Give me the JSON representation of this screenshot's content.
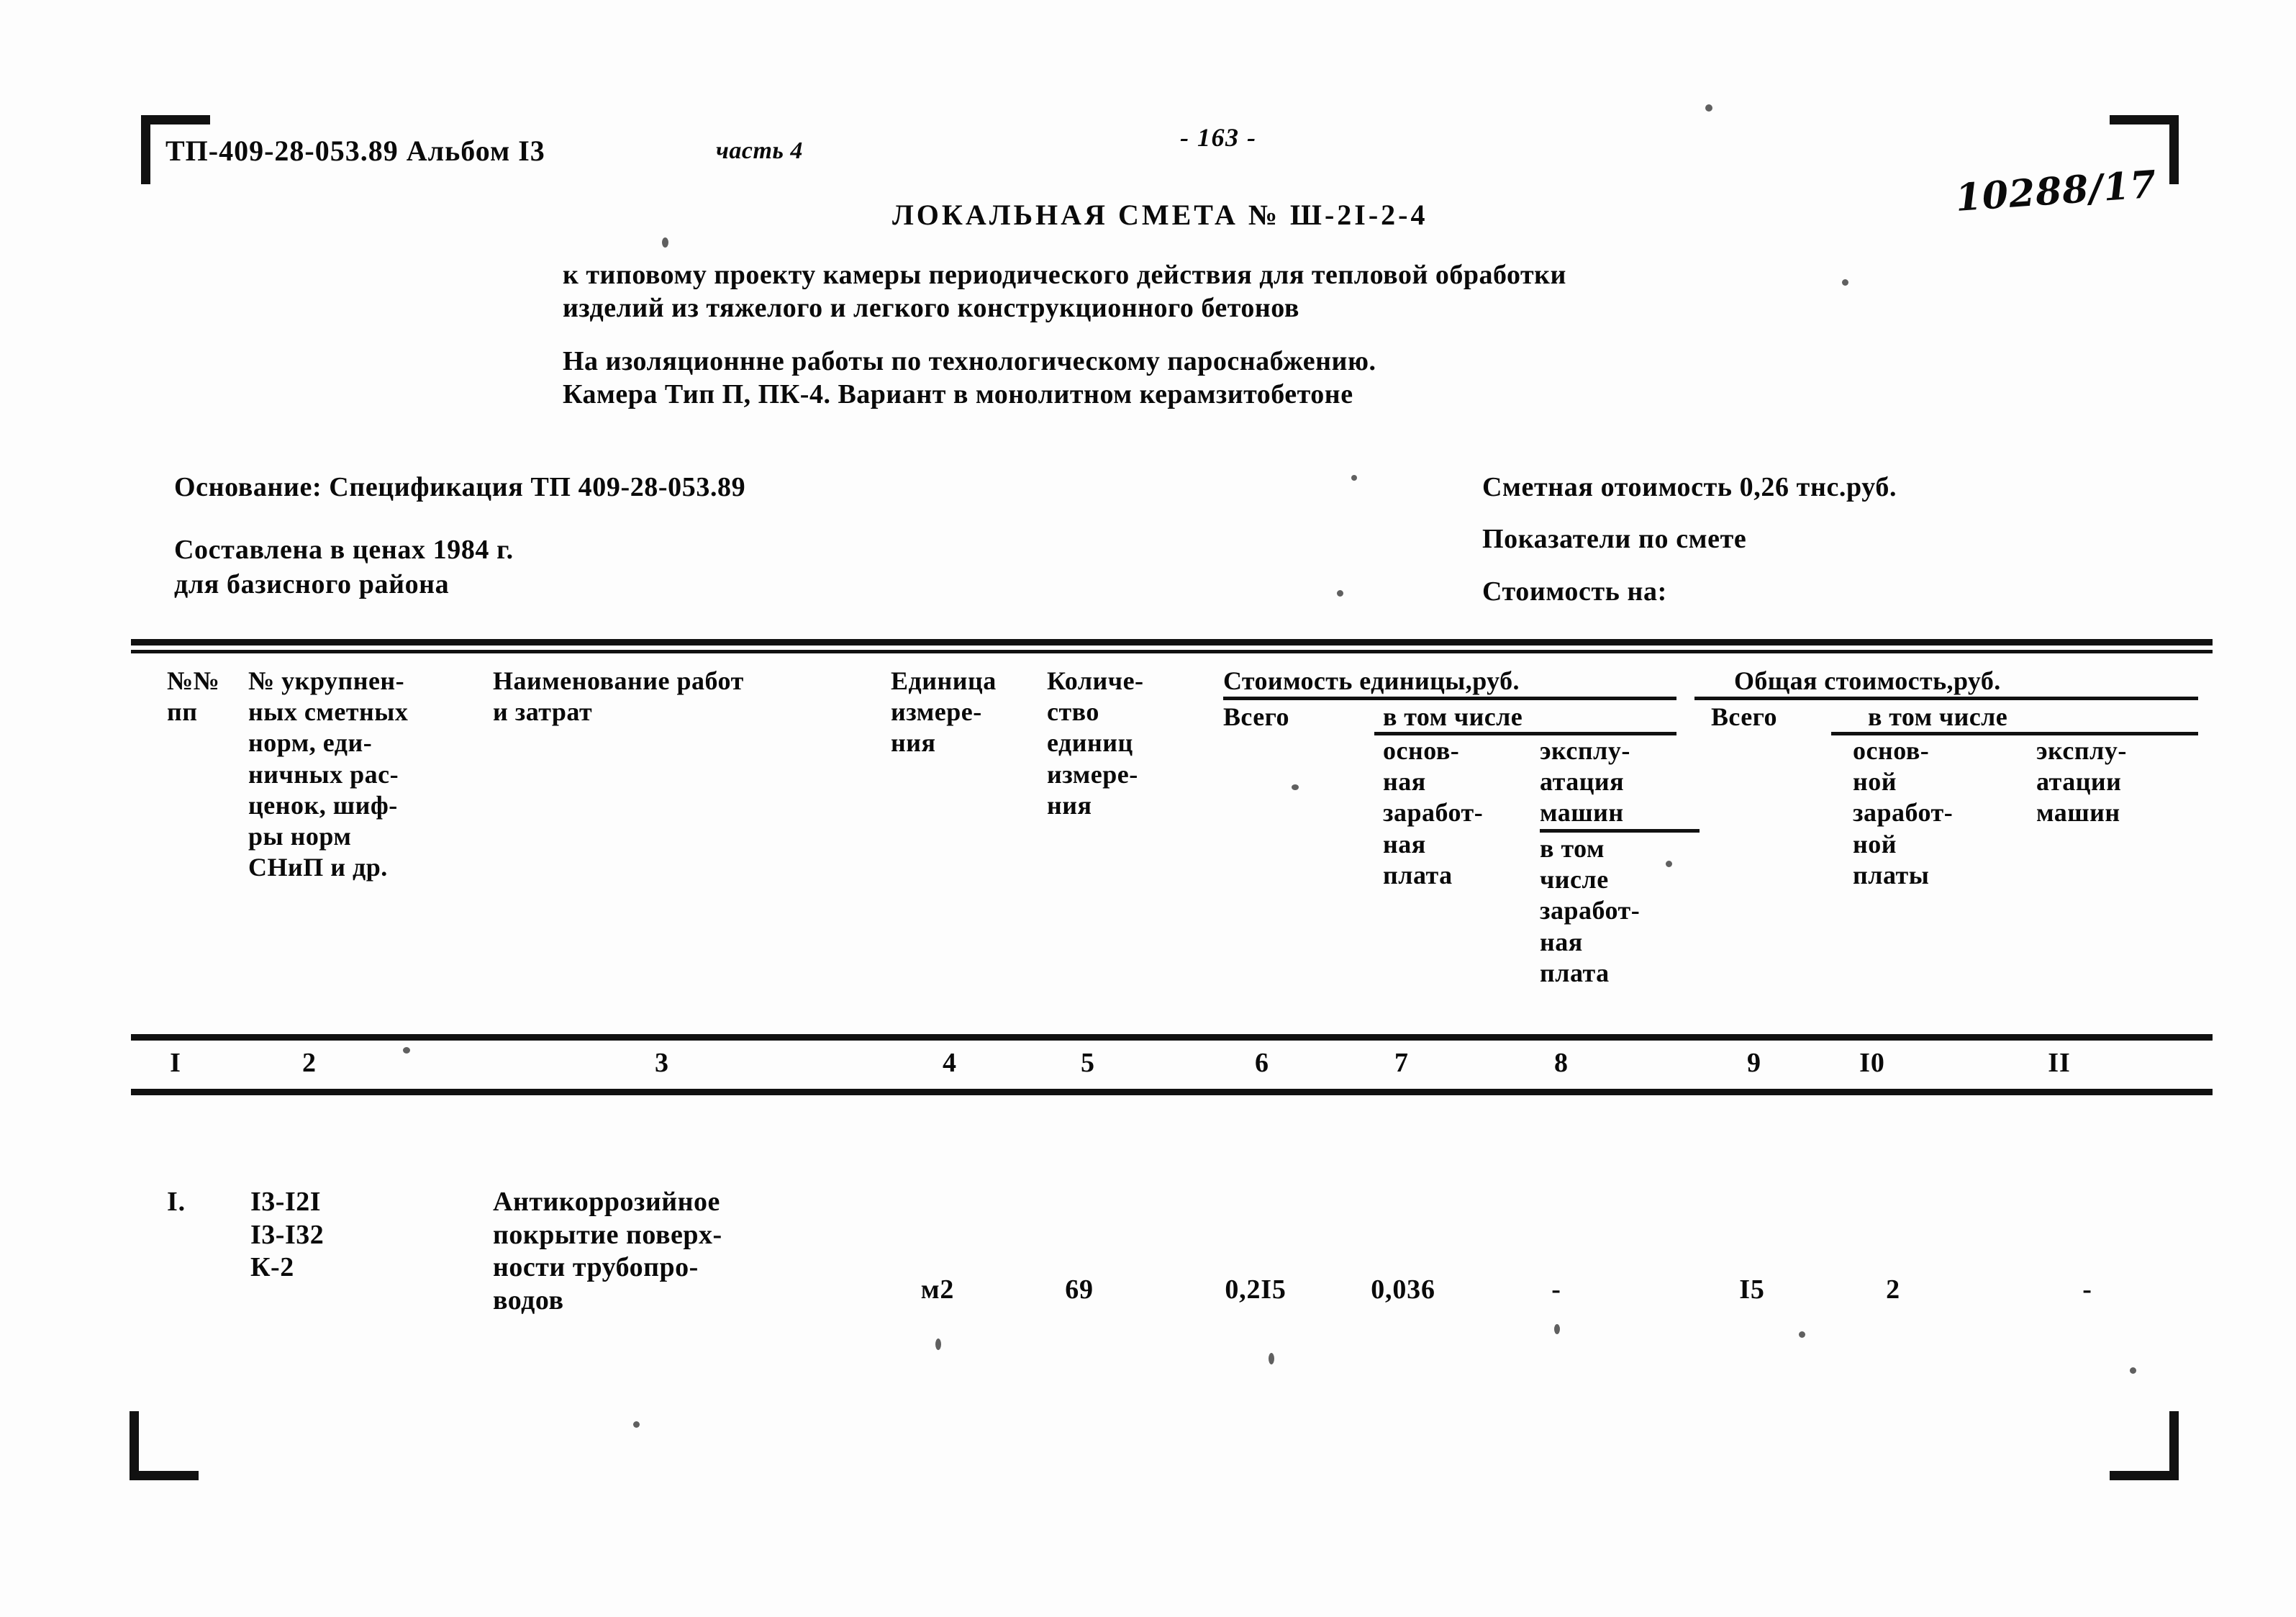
{
  "page": {
    "doc_code": "ТП-409-28-053.89 Альбом I3",
    "part_label": "часть 4",
    "page_number": "- 163 -",
    "stamp_number": "10288/17"
  },
  "header": {
    "title": "ЛОКАЛЬНАЯ СМЕТА № Ш-2I-2-4",
    "subtitle_lines": [
      "к типовому проекту камеры периодического действия для тепловой обработки",
      "изделий из тяжелого и легкого конструкционного бетонов"
    ],
    "scope_lines": [
      "На изоляционнне работы по технологическому пароснабжению.",
      "Камера Тип П, ПК-4. Вариант в монолитном керамзитобетоне"
    ]
  },
  "meta": {
    "left": [
      "Основание: Спецификация ТП 409-28-053.89",
      "Составлена в ценах 1984 г.",
      "для базисного района"
    ],
    "right": [
      "Сметная отоимость 0,26 тнс.руб.",
      "Показатели по смете",
      "Стоимость на:"
    ]
  },
  "table": {
    "headers": {
      "col1": [
        "№№",
        "пп"
      ],
      "col2": [
        "№ укрупнен-",
        "ных сметных",
        "норм, еди-",
        "ничных рас-",
        "ценок, шиф-",
        "ры норм",
        "СНиП и др."
      ],
      "col3": [
        "Наименование работ",
        "и затрат"
      ],
      "col4": [
        "Единица",
        "измере-",
        "ния"
      ],
      "col5": [
        "Количе-",
        "ство",
        "единиц",
        "измере-",
        "ния"
      ],
      "group_unit_cost": "Стоимость единицы,руб.",
      "col6": [
        "Всего"
      ],
      "sub_included_left": "в том числе",
      "col7": [
        "основ-",
        "ная",
        "заработ-",
        "ная",
        "плата"
      ],
      "col8": [
        "эксплу-",
        "атация",
        "машин"
      ],
      "col8b": [
        "в том",
        "числе",
        "заработ-",
        "ная",
        "плата"
      ],
      "group_total_cost": "Общая стоимость,руб.",
      "col9": [
        "Всего"
      ],
      "sub_included_right": "в том числе",
      "col10": [
        "основ-",
        "ной",
        "заработ-",
        "ной",
        "платы"
      ],
      "col11": [
        "эксплу-",
        "атации",
        "машин"
      ]
    },
    "column_numbers": [
      "I",
      "2",
      "3",
      "4",
      "5",
      "6",
      "7",
      "8",
      "9",
      "I0",
      "II"
    ],
    "rows": [
      {
        "no": "I.",
        "norm_codes": [
          "I3-I2I",
          "I3-I32",
          "К-2"
        ],
        "description": [
          "Антикоррозийное",
          "покрытие поверх-",
          "ности трубопро-",
          "водов"
        ],
        "unit": "м2",
        "quantity": "69",
        "unit_total": "0,2I5",
        "unit_basic_wage": "0,036",
        "unit_machines": "-",
        "total": "I5",
        "total_basic_wage": "2",
        "total_machines": "-"
      }
    ]
  }
}
